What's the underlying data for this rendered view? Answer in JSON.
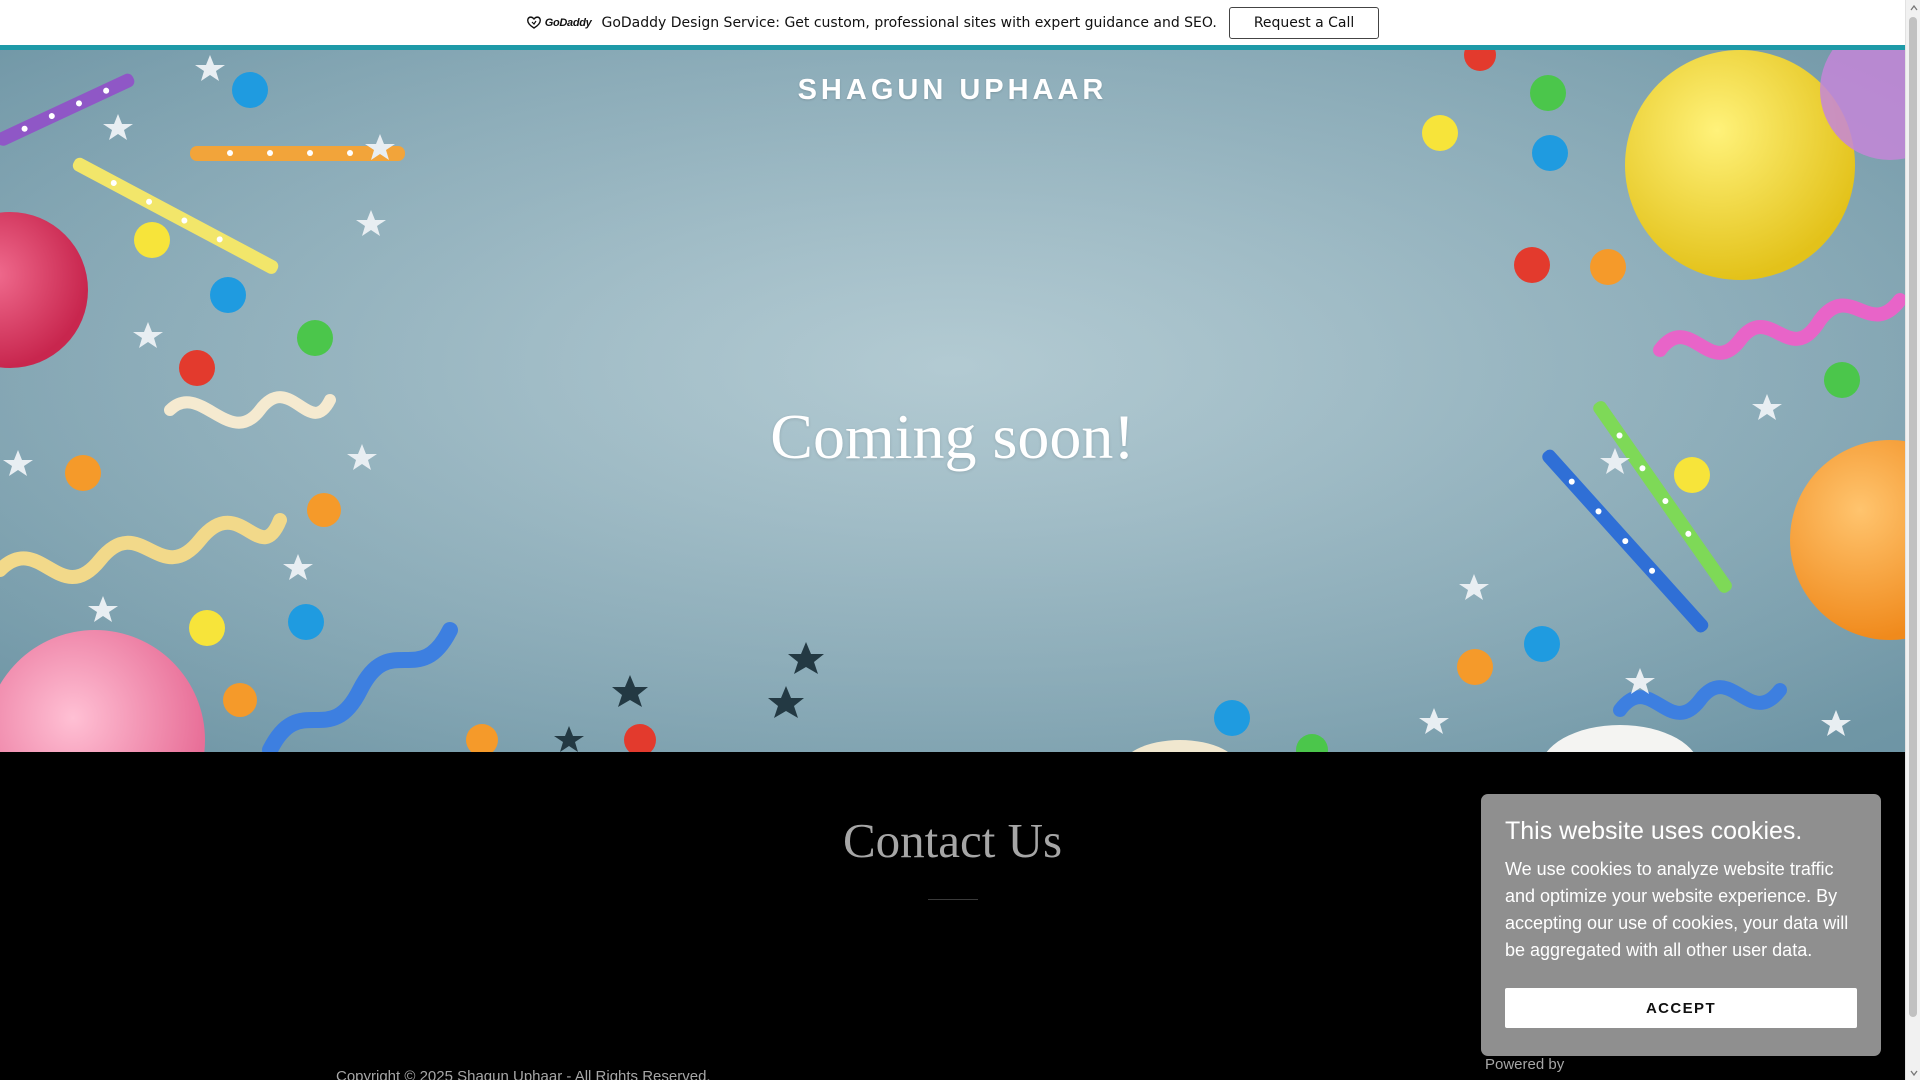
{
  "promo": {
    "logo_text": "GoDaddy",
    "message": "GoDaddy Design Service: Get custom, professional sites with expert guidance and SEO.",
    "cta_label": "Request a Call"
  },
  "hero": {
    "site_title": "SHAGUN UPHAAR",
    "heading": "Coming soon!"
  },
  "contact": {
    "heading": "Contact Us"
  },
  "footer": {
    "copyright": "Copyright © 2025 Shagun Uphaar - All Rights Reserved.",
    "powered_by": "Powered by"
  },
  "cookie_banner": {
    "title": "This website uses cookies.",
    "body": "We use cookies to analyze website traffic and optimize your website experience. By accepting our use of cookies, your data will be aggregated with all other user data.",
    "accept_label": "ACCEPT"
  },
  "colors": {
    "accent_bar": "#1e9aa8",
    "hero_background": "#93b3bf",
    "cookie_panel": "#8f8f8f",
    "contact_background": "#000000"
  }
}
